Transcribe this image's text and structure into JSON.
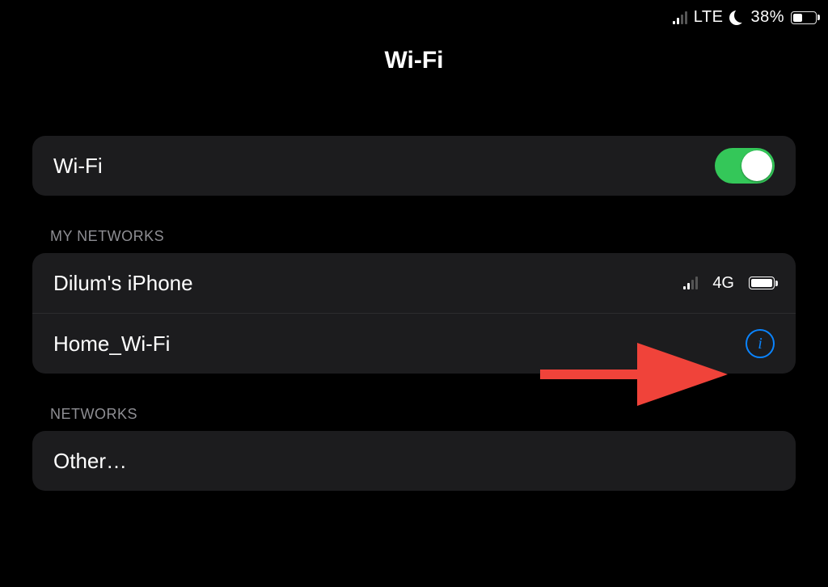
{
  "status_bar": {
    "network_label": "LTE",
    "battery_percent": "38%"
  },
  "page_title": "Wi-Fi",
  "wifi_switch": {
    "label": "Wi-Fi",
    "on": true
  },
  "sections": {
    "my_networks": {
      "header": "MY NETWORKS",
      "items": [
        {
          "name": "Dilum's iPhone",
          "badge_network": "4G"
        },
        {
          "name": "Home_Wi-Fi"
        }
      ]
    },
    "networks": {
      "header": "NETWORKS",
      "items": [
        {
          "name": "Other…"
        }
      ]
    }
  },
  "colors": {
    "accent_blue": "#0a84ff",
    "toggle_green": "#34c759",
    "annotation_red": "#f0433a",
    "card_bg": "#1c1c1e"
  }
}
